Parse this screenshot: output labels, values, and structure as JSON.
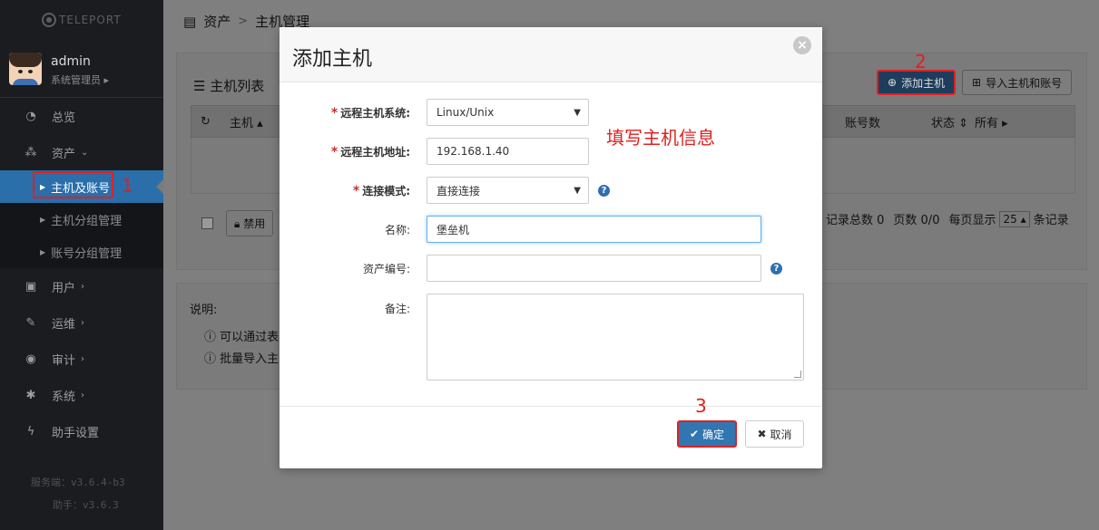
{
  "sidebar": {
    "logo_text": "TELEPORT",
    "user": {
      "name": "admin",
      "role": "系统管理员"
    },
    "nav": [
      {
        "label": "总览",
        "icon": "dashboard-icon",
        "has_arrow": false
      },
      {
        "label": "资产",
        "icon": "sitemap-icon",
        "has_arrow": true
      }
    ],
    "sub_items": [
      {
        "label": "主机及账号",
        "active": true
      },
      {
        "label": "主机分组管理",
        "active": false
      },
      {
        "label": "账号分组管理",
        "active": false
      }
    ],
    "nav_rest": [
      {
        "label": "用户",
        "icon": "user-icon"
      },
      {
        "label": "运维",
        "icon": "wrench-icon"
      },
      {
        "label": "审计",
        "icon": "eye-icon"
      },
      {
        "label": "系统",
        "icon": "gear-icon"
      },
      {
        "label": "助手设置",
        "icon": "bolt-icon"
      }
    ],
    "version_server": "服务端：v3.6.4-b3",
    "version_helper": "助手：v3.6.3"
  },
  "breadcrumb": {
    "section": "资产",
    "page": "主机管理"
  },
  "host_list": {
    "title": "主机列表",
    "add_button": "添加主机",
    "import_button": "导入主机和账号",
    "columns": {
      "host": "主机",
      "accounts": "账号数",
      "status": "状态",
      "all": "所有"
    },
    "disable_button": "禁用",
    "paging": {
      "total": "记录总数 0",
      "pages": "页数 0/0",
      "per_page_label": "每页显示",
      "per_page_value": "25",
      "suffix": "条记录"
    }
  },
  "notes": {
    "title": "说明:",
    "lines": [
      "可以通过表",
      "批量导入主"
    ]
  },
  "modal": {
    "title": "添加主机",
    "close_glyph": "×",
    "fields": {
      "os": {
        "label": "远程主机系统:",
        "value": "Linux/Unix"
      },
      "address": {
        "label": "远程主机地址:",
        "value": "192.168.1.40"
      },
      "mode": {
        "label": "连接模式:",
        "value": "直接连接"
      },
      "name": {
        "label": "名称:",
        "value": "堡垒机"
      },
      "asset_no": {
        "label": "资产编号:",
        "value": ""
      },
      "remark": {
        "label": "备注:",
        "value": ""
      }
    },
    "annotation": "填写主机信息",
    "ok_button": "确定",
    "cancel_button": "取消"
  },
  "steps": {
    "one": "1",
    "two": "2",
    "three": "3"
  },
  "colors": {
    "sidebar_active": "#2a6eaa",
    "primary": "#3276b1",
    "annotation_red": "#e02020",
    "required_star": "#c9302c"
  }
}
